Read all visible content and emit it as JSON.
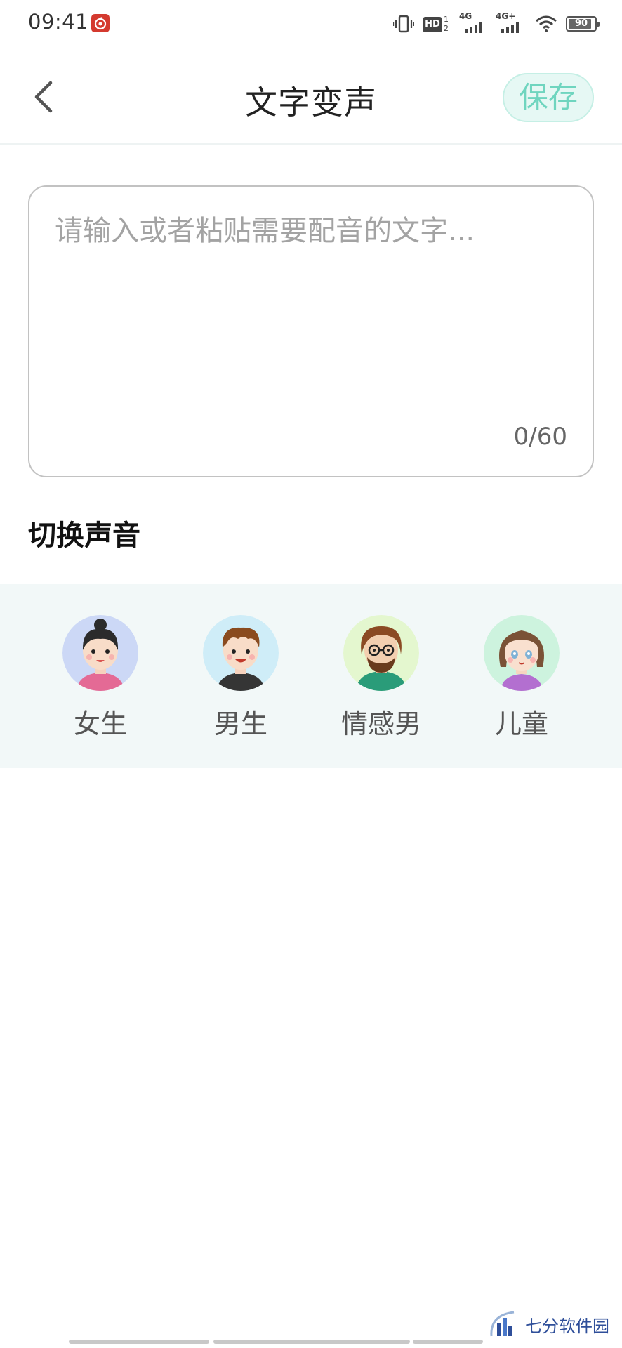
{
  "status_bar": {
    "time": "09:41",
    "battery": "90",
    "battery_level": 0.9,
    "hd_sub": "1\n2",
    "sig1_label": "4G",
    "sig2_label": "4G+",
    "icons": [
      "netease-music-icon",
      "vibrate-icon",
      "hd-icon",
      "signal-icon",
      "signal-icon",
      "wifi-icon",
      "battery-icon"
    ]
  },
  "header": {
    "title": "文字变声",
    "save_label": "保存",
    "accent_color": "#6fd5bf"
  },
  "editor": {
    "placeholder": "请输入或者粘贴需要配音的文字...",
    "value": "",
    "count": "0/60"
  },
  "voices": {
    "section_title": "切换声音",
    "items": [
      {
        "label": "女生"
      },
      {
        "label": "男生"
      },
      {
        "label": "情感男"
      },
      {
        "label": "儿童"
      }
    ]
  },
  "watermark": {
    "text": "七分软件园"
  }
}
